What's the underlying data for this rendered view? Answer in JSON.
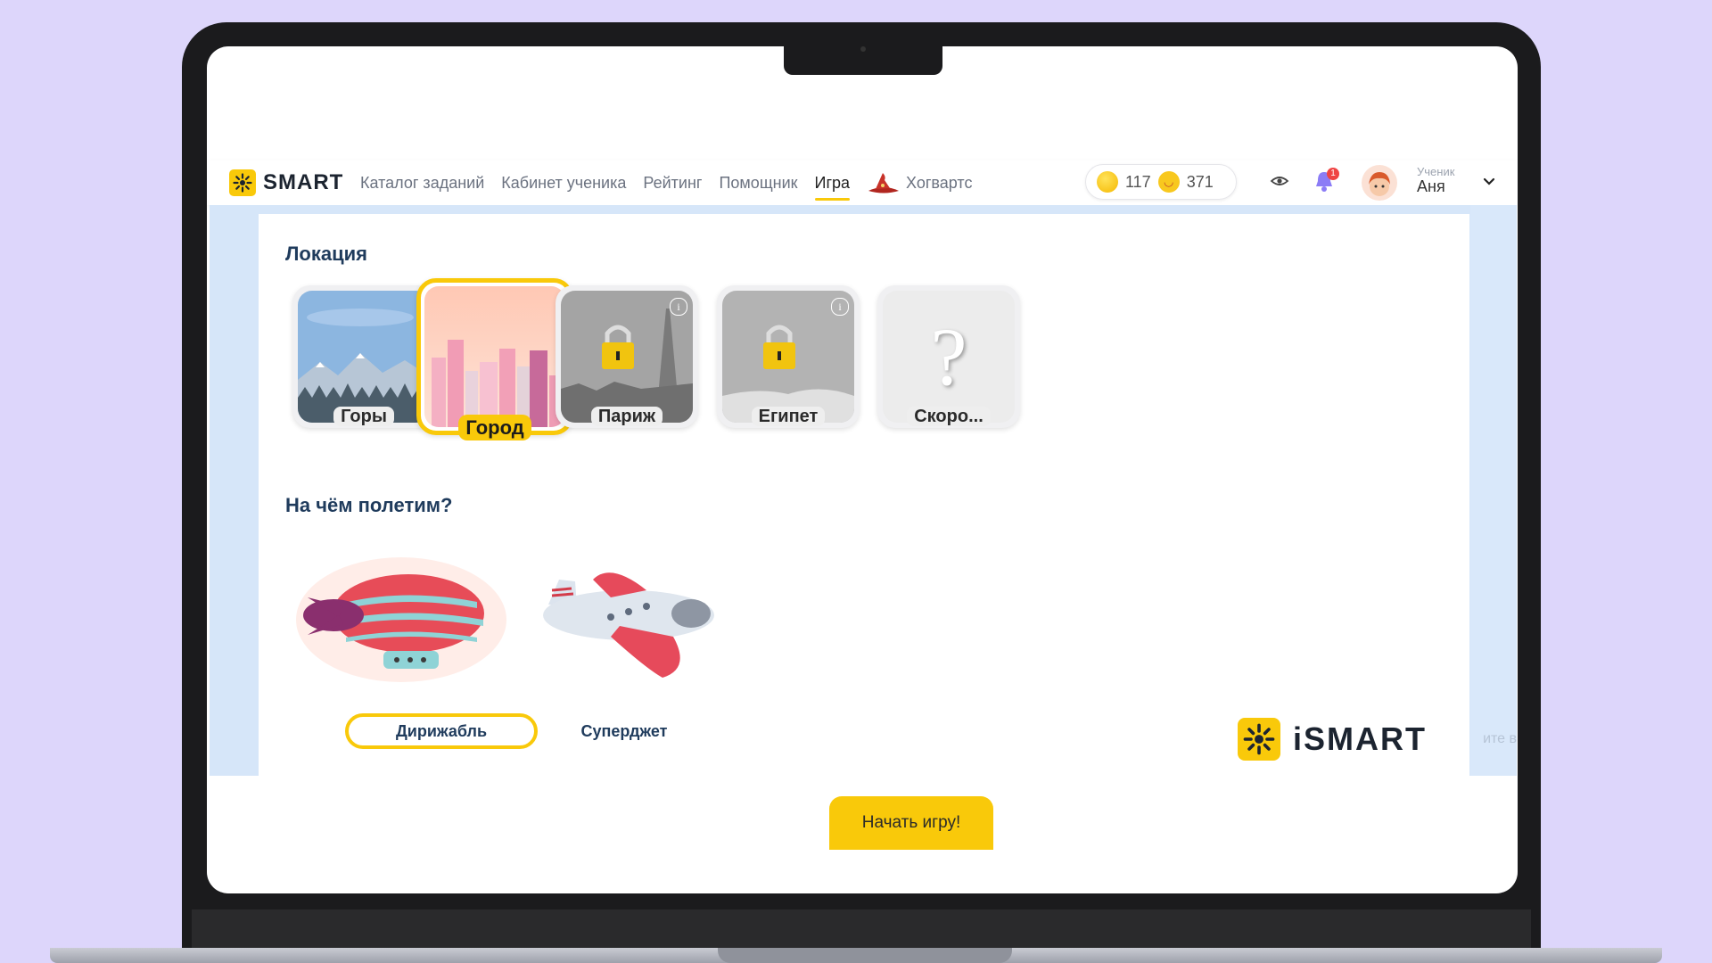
{
  "header": {
    "logo_text": "SMART",
    "nav": [
      {
        "label": "Каталог заданий"
      },
      {
        "label": "Кабинет ученика"
      },
      {
        "label": "Рейтинг"
      },
      {
        "label": "Помощник"
      },
      {
        "label": "Игра",
        "active": true
      },
      {
        "label": "Хогвартс"
      }
    ],
    "coins": "117",
    "smiles": "371",
    "notifications": "1",
    "user_role": "Ученик",
    "user_name": "Аня"
  },
  "game": {
    "location_title": "Локация",
    "locations": [
      {
        "label": "Горы",
        "locked": false
      },
      {
        "label": "Город",
        "locked": false,
        "selected": true
      },
      {
        "label": "Париж",
        "locked": true
      },
      {
        "label": "Египет",
        "locked": true
      },
      {
        "label": "Скоро...",
        "locked": true
      }
    ],
    "vehicle_title": "На чём полетим?",
    "vehicles": [
      {
        "label": "Дирижабль",
        "selected": true
      },
      {
        "label": "Суперджет",
        "selected": false
      }
    ],
    "start_button": "Начать игру!",
    "side_text": "ите в"
  },
  "brand": {
    "text": "iSMART"
  },
  "colors": {
    "accent": "#f9c90a",
    "title": "#1f3b5c",
    "background": "#ddd6fb"
  }
}
